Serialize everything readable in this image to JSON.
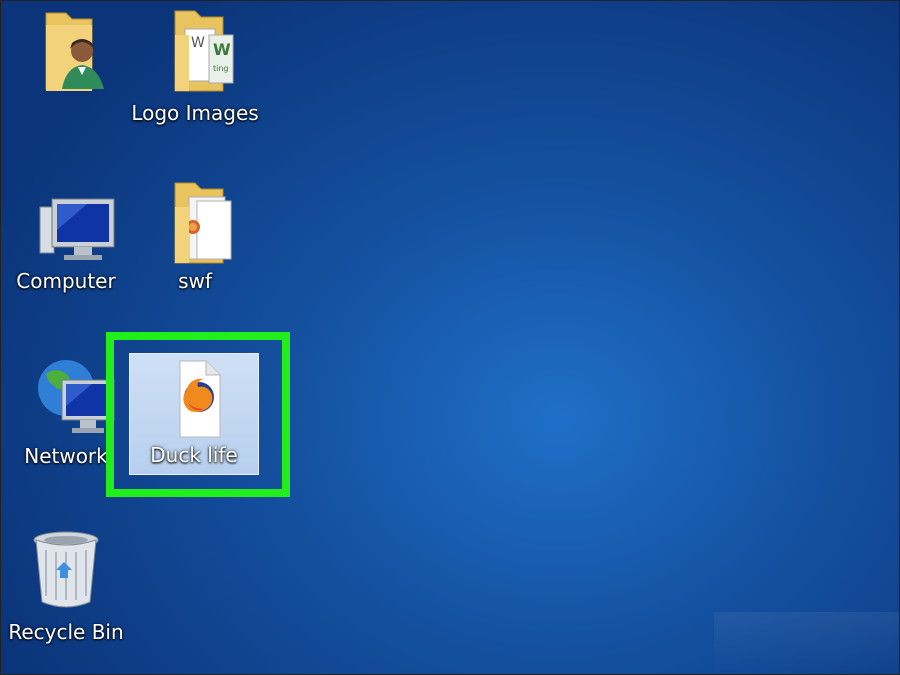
{
  "desktop": {
    "icons": [
      {
        "label": "",
        "icon": "user-folder-icon"
      },
      {
        "label": "Logo Images",
        "icon": "folder-icon"
      },
      {
        "label": "Computer",
        "icon": "computer-icon"
      },
      {
        "label": "swf",
        "icon": "folder-icon"
      },
      {
        "label": "Network",
        "icon": "network-icon"
      },
      {
        "label": "Duck life",
        "icon": "firefox-file-icon",
        "selected": true
      },
      {
        "label": "Recycle Bin",
        "icon": "recycle-bin-icon"
      }
    ]
  },
  "colors": {
    "desktop_background": "#14509f",
    "highlight": "#22ee1c",
    "selection": "#b7cfee"
  }
}
